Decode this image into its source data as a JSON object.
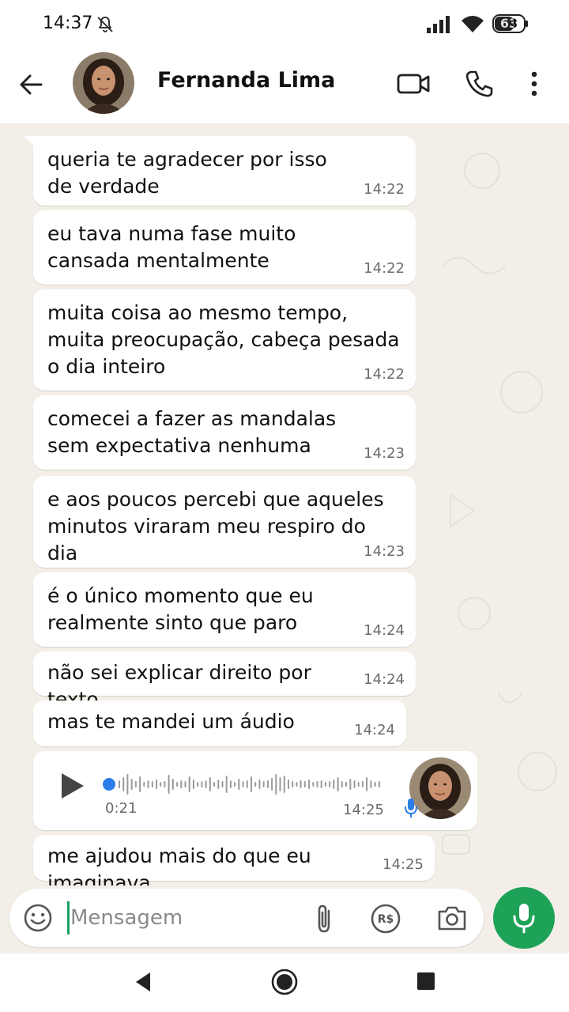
{
  "status_bar": {
    "time": "14:37",
    "battery_level": "63",
    "icons": [
      "bell-off-icon",
      "signal-icon",
      "wifi-icon",
      "battery-icon"
    ]
  },
  "header": {
    "contact_name": "Fernanda Lima",
    "icons": [
      "back-arrow-icon",
      "video-call-icon",
      "phone-icon",
      "more-vert-icon"
    ]
  },
  "messages": [
    {
      "text": "queria te agradecer por isso de verdade",
      "time": "14:22"
    },
    {
      "text": "eu tava numa fase muito cansada mentalmente",
      "time": "14:22"
    },
    {
      "text": "muita coisa ao mesmo tempo, muita preocupação, cabeça pesada o dia inteiro",
      "time": "14:22"
    },
    {
      "text": "comecei a fazer as mandalas sem expectativa nenhuma",
      "time": "14:23"
    },
    {
      "text": "e aos poucos percebi que aqueles minutos viraram meu respiro do dia",
      "time": "14:23"
    },
    {
      "text": "é o único momento que eu realmente sinto que paro",
      "time": "14:24"
    },
    {
      "text": "não sei explicar direito por texto",
      "time": "14:24"
    },
    {
      "text": "mas te mandei um áudio",
      "time": "14:24"
    }
  ],
  "voice_message": {
    "duration": "0:21",
    "time": "14:25",
    "progress": 0
  },
  "last_message": {
    "text": "me ajudou mais do que eu imaginava",
    "time": "14:25"
  },
  "input": {
    "placeholder": "Mensagem",
    "value": "",
    "icons": [
      "emoji-icon",
      "attach-icon",
      "payment-icon",
      "camera-icon",
      "mic-icon"
    ]
  },
  "colors": {
    "chat_background": "#f3efe8",
    "bubble": "#ffffff",
    "accent_green": "#1ea257",
    "voice_progress": "#2b7de9",
    "timestamp": "#6b6b6b"
  }
}
